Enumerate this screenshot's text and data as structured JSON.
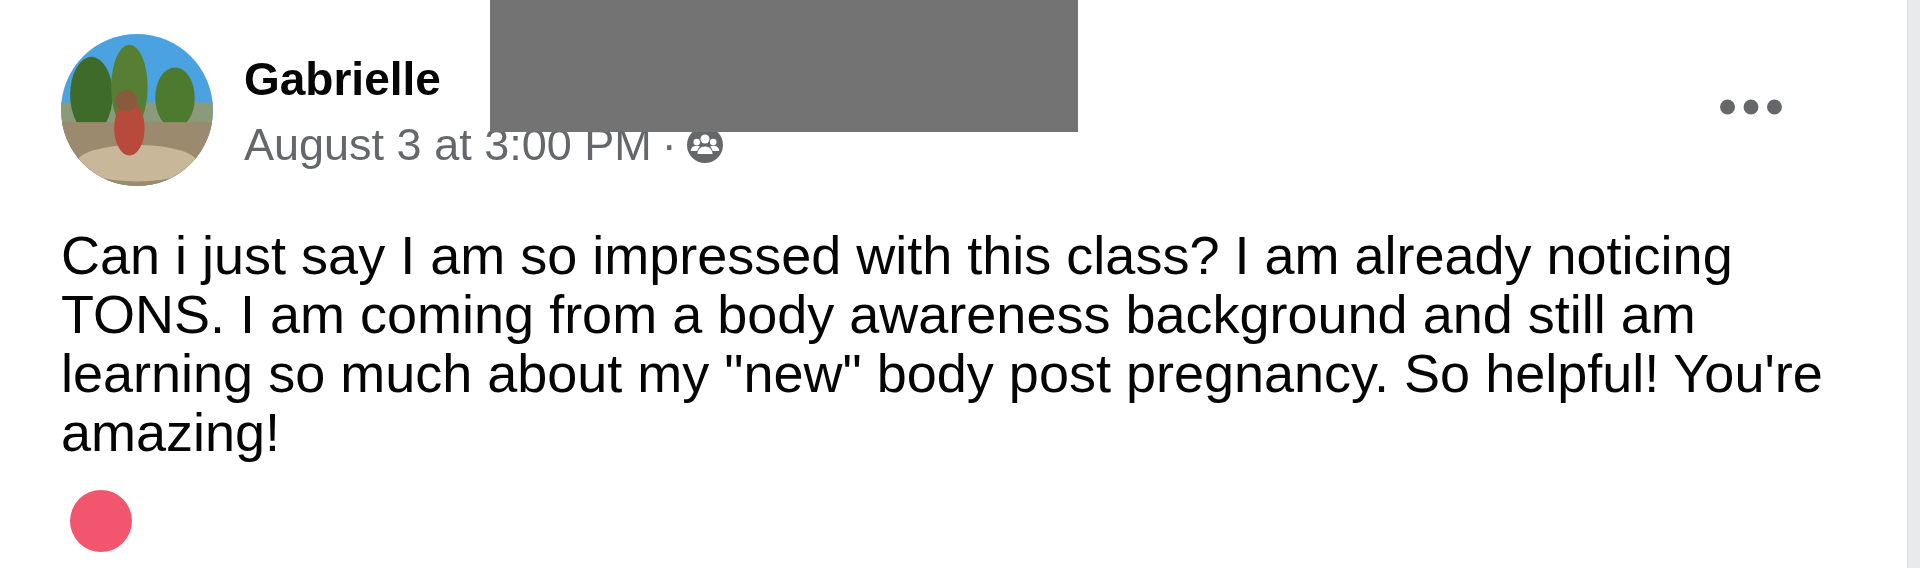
{
  "post": {
    "author": "Gabrielle",
    "timestamp": "August 3 at 3:00 PM",
    "separator": "·",
    "redacted": true,
    "body": "Can i just say I am so impressed with this class? I am already noticing TONS. I am coming from a body awareness background and still am learning so much about my \"new\" body post pregnancy. So helpful! You're amazing!"
  }
}
